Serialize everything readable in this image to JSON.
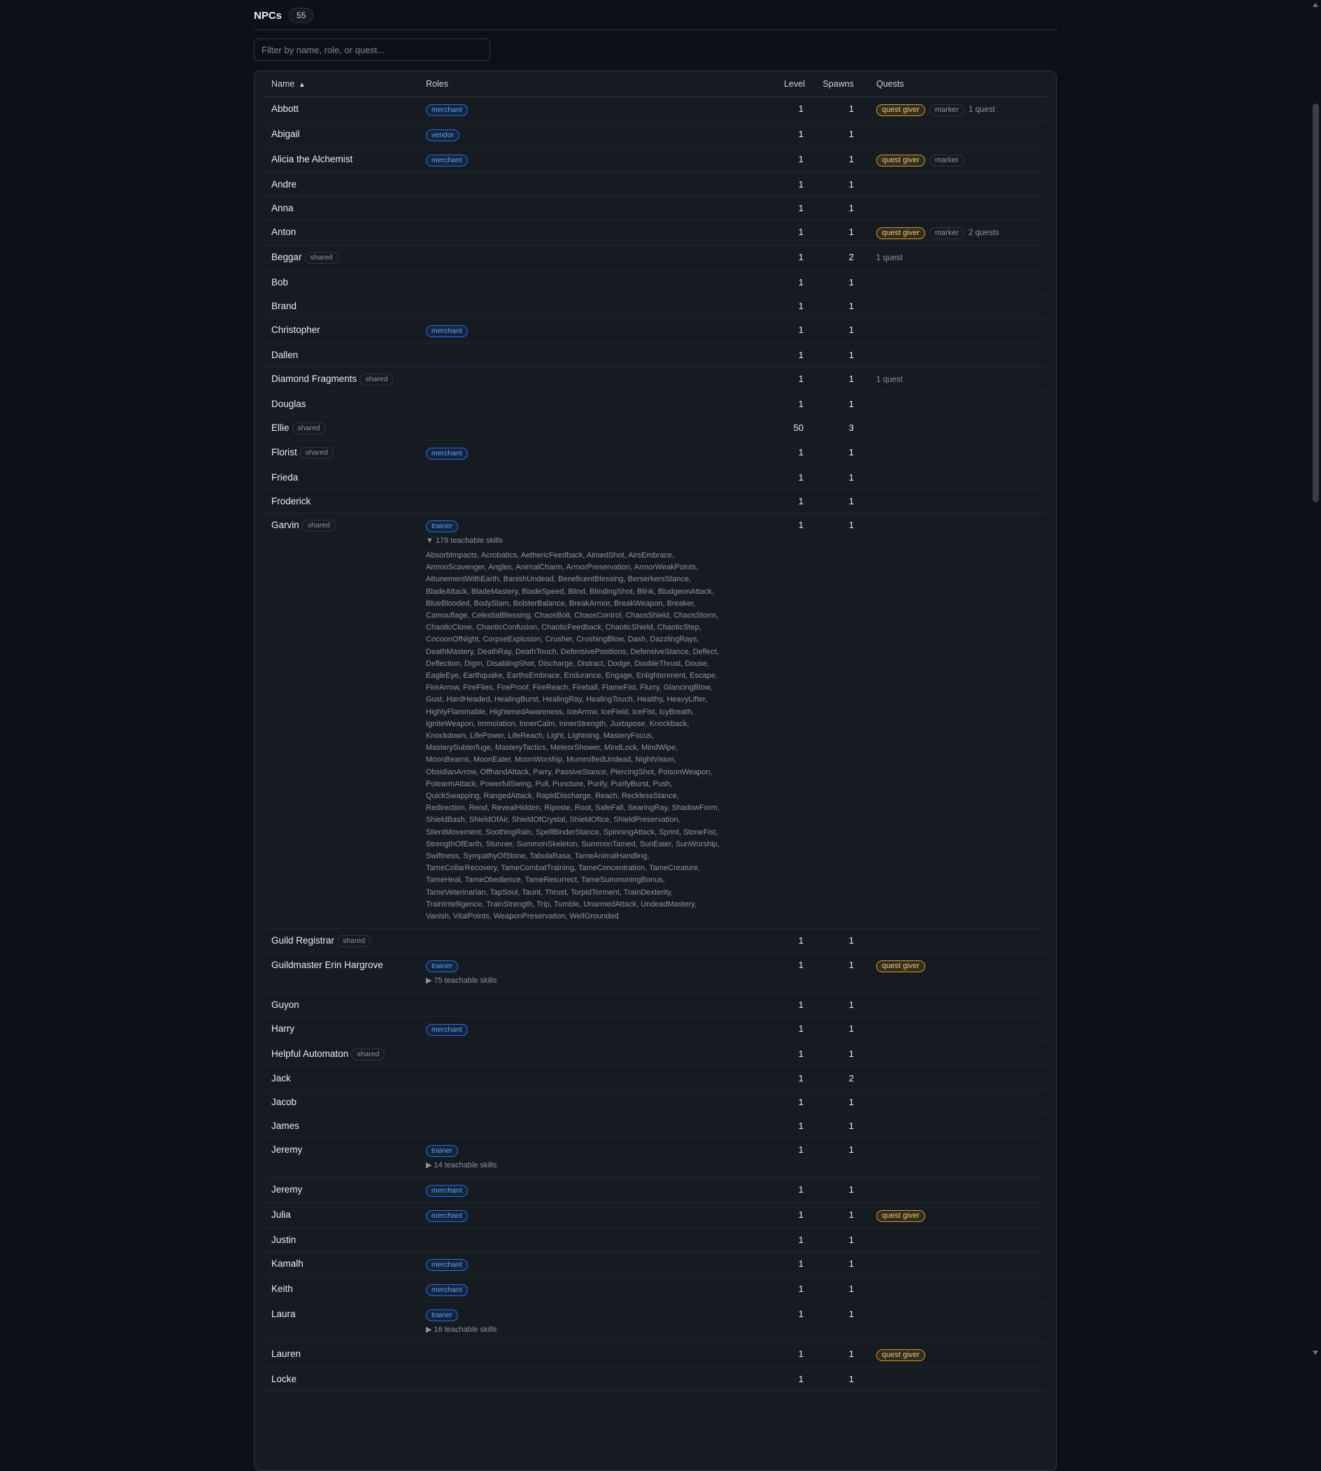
{
  "header": {
    "title": "NPCs",
    "count": "55"
  },
  "filter": {
    "placeholder": "Filter by name, role, or quest..."
  },
  "columns": {
    "name": "Name",
    "sort_indicator": "▲",
    "roles": "Roles",
    "level": "Level",
    "spawns": "Spawns",
    "quests": "Quests"
  },
  "icons": {
    "sort": "sort-ascending-icon",
    "expanded": "triangle-down-icon",
    "collapsed": "triangle-right-icon"
  },
  "colors": {
    "background": "#0d1117",
    "card": "#161b22",
    "role_badge": "#58a6ff",
    "quest_giver": "#d29922"
  },
  "rows": [
    {
      "name": "Abbott",
      "roles": [
        "merchant"
      ],
      "level": "1",
      "spawns": "1",
      "quest_giver": "quest giver",
      "marker": "marker",
      "quest_count": "1 quest"
    },
    {
      "name": "Abigail",
      "roles": [
        "vendor"
      ],
      "level": "1",
      "spawns": "1"
    },
    {
      "name": "Alicia the Alchemist",
      "roles": [
        "merchant"
      ],
      "level": "1",
      "spawns": "1",
      "quest_giver": "quest giver",
      "marker": "marker"
    },
    {
      "name": "Andre",
      "roles": [],
      "level": "1",
      "spawns": "1"
    },
    {
      "name": "Anna",
      "roles": [],
      "level": "1",
      "spawns": "1"
    },
    {
      "name": "Anton",
      "roles": [],
      "level": "1",
      "spawns": "1",
      "quest_giver": "quest giver",
      "marker": "marker",
      "quest_count": "2 quests"
    },
    {
      "name": "Beggar",
      "shared": "shared",
      "roles": [],
      "level": "1",
      "spawns": "2",
      "quest_count": "1 quest"
    },
    {
      "name": "Bob",
      "roles": [],
      "level": "1",
      "spawns": "1"
    },
    {
      "name": "Brand",
      "roles": [],
      "level": "1",
      "spawns": "1"
    },
    {
      "name": "Christopher",
      "roles": [
        "merchant"
      ],
      "level": "1",
      "spawns": "1"
    },
    {
      "name": "Dallen",
      "roles": [],
      "level": "1",
      "spawns": "1"
    },
    {
      "name": "Diamond Fragments",
      "shared": "shared",
      "roles": [],
      "level": "1",
      "spawns": "1",
      "quest_count": "1 quest"
    },
    {
      "name": "Douglas",
      "roles": [],
      "level": "1",
      "spawns": "1"
    },
    {
      "name": "Ellie",
      "shared": "shared",
      "roles": [],
      "level": "50",
      "spawns": "3"
    },
    {
      "name": "Florist",
      "shared": "shared",
      "roles": [
        "merchant"
      ],
      "level": "1",
      "spawns": "1"
    },
    {
      "name": "Frieda",
      "roles": [],
      "level": "1",
      "spawns": "1"
    },
    {
      "name": "Froderick",
      "roles": [],
      "level": "1",
      "spawns": "1"
    },
    {
      "name": "Garvin",
      "shared": "shared",
      "roles": [
        "trainer"
      ],
      "level": "1",
      "spawns": "1",
      "skills_toggle": "▼ 179 teachable skills",
      "skills_open": true,
      "skills": "AbsorbImpacts, Acrobatics, AethericFeedback, AimedShot, AirsEmbrace, AmmoScavenger, Angles, AnimalCharm, ArmorPreservation, ArmorWeakPoints, AttunementWithEarth, BanishUndead, BeneficentBlessing, BerserkersStance, BladeAttack, BladeMastery, BladeSpeed, Blind, BlindingShot, Blink, BludgeonAttack, BlueBlooded, BodySlam, BolsterBalance, BreakArmor, BreakWeapon, Breaker, Camouflage, CelestialBlessing, ChaosBolt, ChaosControl, ChaosShield, ChaosStorm, ChaoticClone, ChaoticConfusion, ChaoticFeedback, ChaoticShield, ChaoticStep, CocoonOfNight, CorpseExplosion, Crusher, CrushingBlow, Dash, DazzlingRays, DeathMastery, DeathRay, DeathTouch, DefensivePositions, DefensiveStance, Deflect, Deflection, DigIn, DisablingShot, Discharge, Distract, Dodge, DoubleThrust, Douse, EagleEye, Earthquake, EarthsEmbrace, Endurance, Engage, Enlightenment, Escape, FireArrow, FireFlies, FireProof, FireReach, Fireball, FlameFist, Flurry, GlancingBlow, Gust, HardHeaded, HealingBurst, HealingRay, HealingTouch, Healthy, HeavyLifter, HighlyFlammable, HightenedAwareness, IceArrow, IceField, IceFist, IcyBreath, IgniteWeapon, Immolation, InnerCalm, InnerStrength, Juxtapose, Knockback, Knockdown, LifePower, LifeReach, Light, Lightning, MasteryFocus, MasterySubterfuge, MasteryTactics, MeteorShower, MindLock, MindWipe, MoonBeams, MoonEater, MoonWorship, MummifiedUndead, NightVision, ObsidianArrow, OffhandAttack, Parry, PassiveStance, PiercingShot, PoisonWeapon, PolearmAttack, PowerfulSwing, Pull, Puncture, Purify, PurifyBurst, Push, QuickSwapping, RangedAttack, RapidDischarge, Reach, RecklessStance, Redirection, Rend, RevealHidden, Riposte, Root, SafeFall, SearingRay, ShadowForm, ShieldBash, ShieldOfAir, ShieldOfCrystal, ShieldOfIce, ShieldPreservation, SilentMovement, SoothingRain, SpellBinderStance, SpinningAttack, Sprint, StoneFist, StrengthOfEarth, Stunner, SummonSkeleton, SummonTamed, SunEater, SunWorship, Swiftness, SympathyOfStone, TabulaRasa, TameAnimalHandling, TameCollarRecovery, TameCombatTraining, TameConcentration, TameCreature, TameHeal, TameObedience, TameResurrect, TameSummoningBonus, TameVeterinarian, TapSoul, Taunt, Thrust, TorpidTorment, TrainDexterity, TrainIntelligence, TrainStrength, Trip, Tumble, UnarmedAttack, UndeadMastery, Vanish, VitalPoints, WeaponPreservation, WellGrounded"
    },
    {
      "name": "Guild Registrar",
      "shared": "shared",
      "roles": [],
      "level": "1",
      "spawns": "1"
    },
    {
      "name": "Guildmaster Erin Hargrove",
      "roles": [
        "trainer"
      ],
      "level": "1",
      "spawns": "1",
      "quest_giver": "quest giver",
      "skills_toggle": "▶ 75 teachable skills"
    },
    {
      "name": "Guyon",
      "roles": [],
      "level": "1",
      "spawns": "1"
    },
    {
      "name": "Harry",
      "roles": [
        "merchant"
      ],
      "level": "1",
      "spawns": "1"
    },
    {
      "name": "Helpful Automaton",
      "shared": "shared",
      "roles": [],
      "level": "1",
      "spawns": "1"
    },
    {
      "name": "Jack",
      "roles": [],
      "level": "1",
      "spawns": "2"
    },
    {
      "name": "Jacob",
      "roles": [],
      "level": "1",
      "spawns": "1"
    },
    {
      "name": "James",
      "roles": [],
      "level": "1",
      "spawns": "1"
    },
    {
      "name": "Jeremy",
      "roles": [
        "trainer"
      ],
      "level": "1",
      "spawns": "1",
      "skills_toggle": "▶ 14 teachable skills"
    },
    {
      "name": "Jeremy",
      "roles": [
        "merchant"
      ],
      "level": "1",
      "spawns": "1"
    },
    {
      "name": "Julia",
      "roles": [
        "merchant"
      ],
      "level": "1",
      "spawns": "1",
      "quest_giver": "quest giver"
    },
    {
      "name": "Justin",
      "roles": [],
      "level": "1",
      "spawns": "1"
    },
    {
      "name": "Kamalh",
      "roles": [
        "merchant"
      ],
      "level": "1",
      "spawns": "1"
    },
    {
      "name": "Keith",
      "roles": [
        "merchant"
      ],
      "level": "1",
      "spawns": "1"
    },
    {
      "name": "Laura",
      "roles": [
        "trainer"
      ],
      "level": "1",
      "spawns": "1",
      "skills_toggle": "▶ 16 teachable skills"
    },
    {
      "name": "Lauren",
      "roles": [],
      "level": "1",
      "spawns": "1",
      "quest_giver": "quest giver"
    },
    {
      "name": "Locke",
      "roles": [],
      "level": "1",
      "spawns": "1"
    }
  ]
}
